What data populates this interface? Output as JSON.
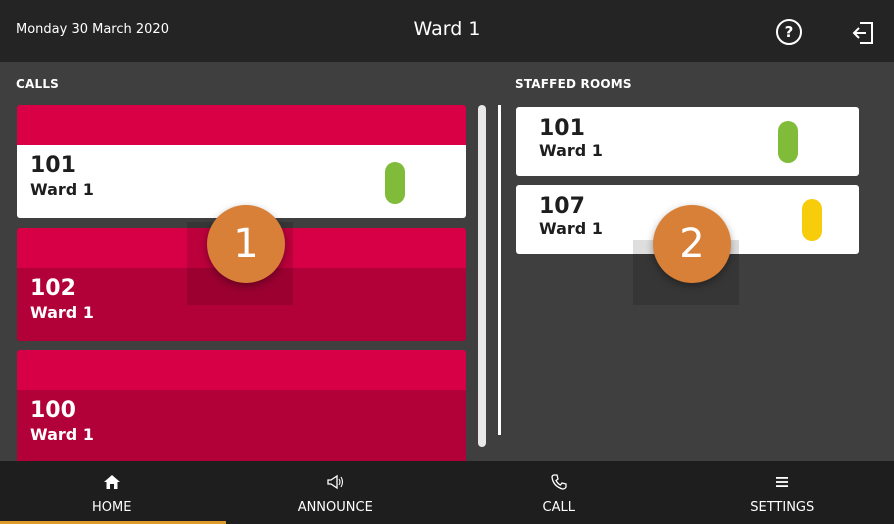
{
  "header": {
    "date": "Monday 30 March 2020",
    "title": "Ward 1",
    "help_icon": "question-circle-icon",
    "help_glyph": "?",
    "logout_icon": "logout-icon"
  },
  "calls": {
    "label": "CALLS",
    "items": [
      {
        "number": "101",
        "ward": "Ward 1",
        "state": "active",
        "status_color": "#80bc3a"
      },
      {
        "number": "102",
        "ward": "Ward 1",
        "state": "inactive"
      },
      {
        "number": "100",
        "ward": "Ward 1",
        "state": "inactive"
      }
    ]
  },
  "staffed_rooms": {
    "label": "STAFFED ROOMS",
    "items": [
      {
        "number": "101",
        "ward": "Ward 1",
        "status_color": "#80bc3a"
      },
      {
        "number": "107",
        "ward": "Ward 1",
        "status_color": "#f6cc0b"
      }
    ]
  },
  "badges": [
    "1",
    "2"
  ],
  "nav": {
    "items": [
      {
        "label": "HOME",
        "icon": "home-icon",
        "selected": true
      },
      {
        "label": "ANNOUNCE",
        "icon": "megaphone-icon",
        "selected": false
      },
      {
        "label": "CALL",
        "icon": "phone-icon",
        "selected": false
      },
      {
        "label": "SETTINGS",
        "icon": "menu-icon",
        "selected": false
      }
    ]
  },
  "colors": {
    "call_strip": "#d90045",
    "call_inactive": "#b20039",
    "accent_selected": "#e09a2a",
    "badge": "#d88037"
  }
}
